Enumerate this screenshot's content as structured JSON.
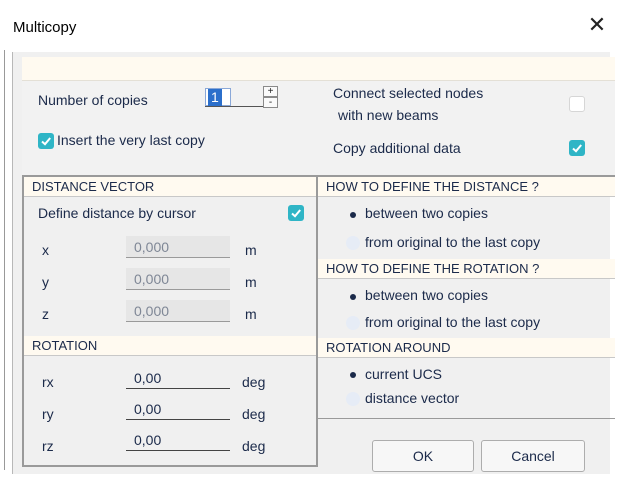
{
  "window": {
    "title": "Multicopy"
  },
  "top": {
    "copies_label": "Number of copies",
    "copies_value": "1",
    "spin_plus": "+",
    "spin_minus": "-",
    "insert_last_label": "Insert the very last copy",
    "insert_last_checked": true,
    "connect_label_line1": "Connect selected nodes",
    "connect_label_line2": "with new beams",
    "connect_checked": false,
    "copy_additional_label": "Copy additional data",
    "copy_additional_checked": true
  },
  "distance_vector": {
    "header": "DISTANCE VECTOR",
    "define_by_cursor_label": "Define distance by cursor",
    "define_by_cursor_checked": true,
    "rows": [
      {
        "label": "x",
        "value": "0,000",
        "unit": "m"
      },
      {
        "label": "y",
        "value": "0,000",
        "unit": "m"
      },
      {
        "label": "z",
        "value": "0,000",
        "unit": "m"
      }
    ]
  },
  "rotation": {
    "header": "ROTATION",
    "rows": [
      {
        "label": "rx",
        "value": "0,00",
        "unit": "deg"
      },
      {
        "label": "ry",
        "value": "0,00",
        "unit": "deg"
      },
      {
        "label": "rz",
        "value": "0,00",
        "unit": "deg"
      }
    ]
  },
  "define_distance": {
    "header": "HOW TO DEFINE THE DISTANCE ?",
    "options": [
      "between two copies",
      "from original to the last copy"
    ],
    "selected": "between two copies"
  },
  "define_rotation": {
    "header": "HOW TO DEFINE THE ROTATION ?",
    "options": [
      "between two copies",
      "from original to the last copy"
    ],
    "selected": "between two copies"
  },
  "rotation_around": {
    "header": "ROTATION AROUND",
    "options": [
      "current UCS",
      "distance vector"
    ],
    "selected": "current UCS"
  },
  "buttons": {
    "ok": "OK",
    "cancel": "Cancel"
  },
  "colors": {
    "check_accent": "#2fb5c6",
    "header_bg": "#fffaf0",
    "panel_bg": "#f2f2f2",
    "text": "#1b2a4a"
  }
}
